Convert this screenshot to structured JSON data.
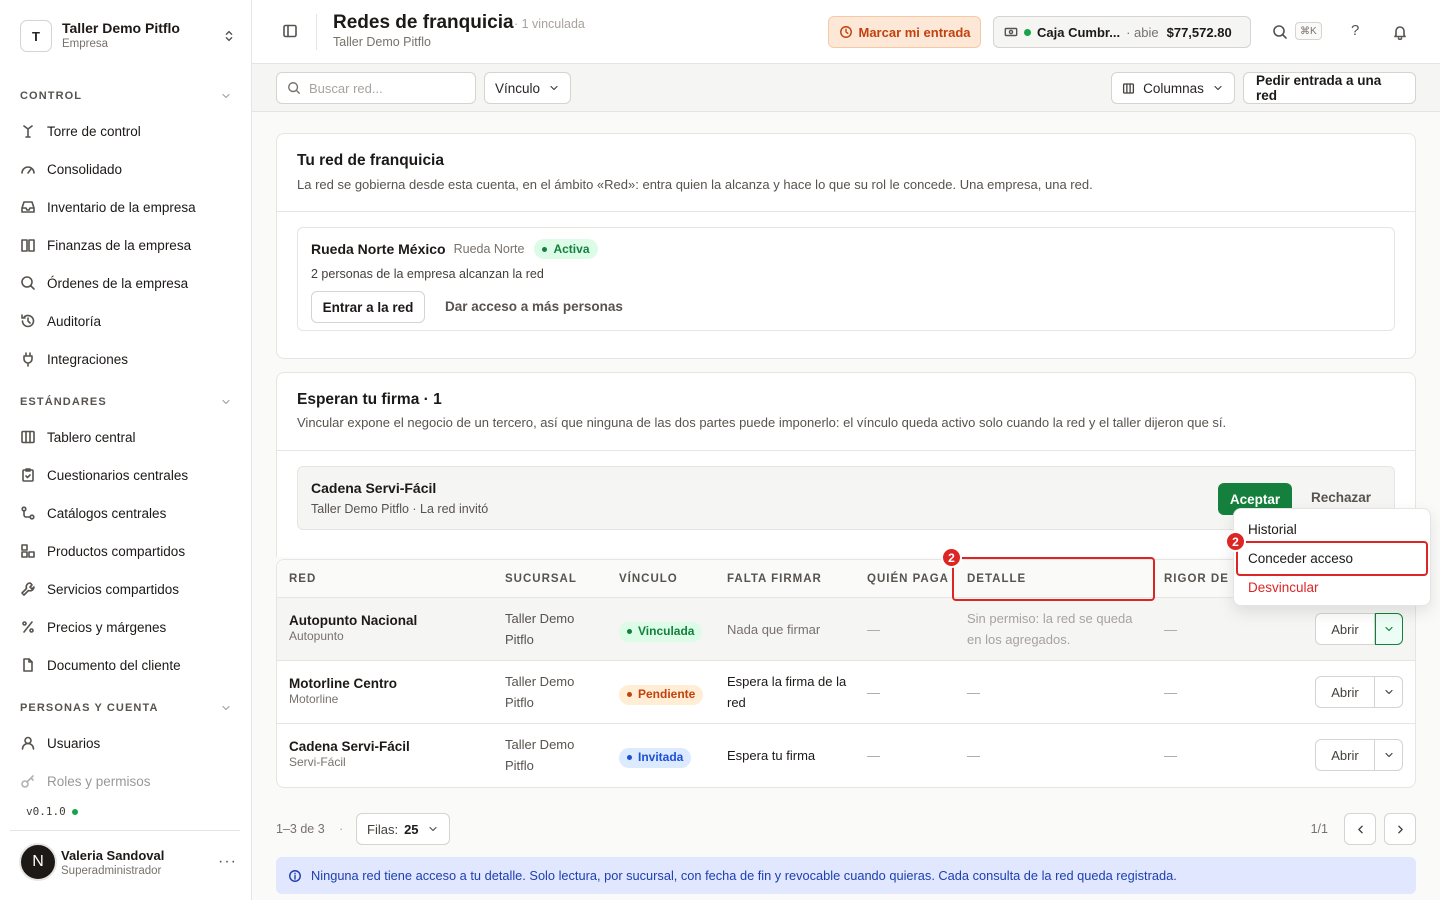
{
  "workspace": {
    "initial": "T",
    "name": "Taller Demo Pitflo",
    "type": "Empresa"
  },
  "sidebar": {
    "sections": [
      {
        "title": "CONTROL",
        "items": [
          {
            "label": "Torre de control",
            "icon": "tower-icon"
          },
          {
            "label": "Consolidado",
            "icon": "gauge-icon"
          },
          {
            "label": "Inventario de la empresa",
            "icon": "inbox-icon"
          },
          {
            "label": "Finanzas de la empresa",
            "icon": "book-icon"
          },
          {
            "label": "Órdenes de la empresa",
            "icon": "search-icon"
          },
          {
            "label": "Auditoría",
            "icon": "history-icon"
          },
          {
            "label": "Integraciones",
            "icon": "plug-icon"
          }
        ]
      },
      {
        "title": "ESTÁNDARES",
        "items": [
          {
            "label": "Tablero central",
            "icon": "columns-icon"
          },
          {
            "label": "Cuestionarios centrales",
            "icon": "clipboard-icon"
          },
          {
            "label": "Catálogos centrales",
            "icon": "hierarchy-icon"
          },
          {
            "label": "Productos compartidos",
            "icon": "boxes-icon"
          },
          {
            "label": "Servicios compartidos",
            "icon": "wrench-icon"
          },
          {
            "label": "Precios y márgenes",
            "icon": "percent-icon"
          },
          {
            "label": "Documento del cliente",
            "icon": "document-icon"
          }
        ]
      },
      {
        "title": "PERSONAS Y CUENTA",
        "items": [
          {
            "label": "Usuarios",
            "icon": "user-icon"
          },
          {
            "label": "Roles y permisos",
            "icon": "key-icon"
          }
        ]
      }
    ],
    "version": "v0.1.0",
    "user": {
      "initial": "N",
      "name": "Valeria Sandoval",
      "role": "Superadministrador",
      "more": "···"
    }
  },
  "header": {
    "title": "Redes de franquicia",
    "count": "· 1 vinculada",
    "subtitle": "Taller Demo Pitflo",
    "entry_button": "Marcar mi entrada",
    "cash": {
      "name": "Caja Cumbr...",
      "status": "· abie",
      "amount": "$77,572.80"
    },
    "shortcut": "⌘K",
    "help": "?"
  },
  "toolbar": {
    "search_placeholder": "Buscar red...",
    "filter_label": "Vínculo",
    "columns_label": "Columnas",
    "request_label": "Pedir entrada a una red"
  },
  "own_network": {
    "title": "Tu red de franquicia",
    "description": "La red se gobierna desde esta cuenta, en el ámbito «Red»: entra quien la alcanza y hace lo que su rol le concede. Una empresa, una red.",
    "name": "Rueda Norte México",
    "short": "Rueda Norte",
    "status": "Activa",
    "reach": "2 personas de la empresa alcanzan la red",
    "enter_button": "Entrar a la red",
    "grant_link": "Dar acceso a más personas"
  },
  "pending": {
    "title": "Esperan tu firma · 1",
    "description": "Vincular expone el negocio de un tercero, así que ninguna de las dos partes puede imponerlo: el vínculo queda activo solo cuando la red y el taller dijeron que sí.",
    "name": "Cadena Servi-Fácil",
    "meta": "Taller Demo Pitflo · La red invitó",
    "accept": "Aceptar",
    "reject": "Rechazar"
  },
  "table": {
    "columns": [
      "RED",
      "SUCURSAL",
      "VÍNCULO",
      "FALTA FIRMAR",
      "QUIÉN PAGA",
      "DETALLE",
      "RIGOR DE L"
    ],
    "rows": [
      {
        "name": "Autopunto Nacional",
        "short": "Autopunto",
        "branch": "Taller Demo Pitflo",
        "status": "Vinculada",
        "missing": "Nada que firmar",
        "payer": "—",
        "detail": "Sin permiso: la red se queda en los agregados.",
        "rigor": "—",
        "action": "Abrir"
      },
      {
        "name": "Motorline Centro",
        "short": "Motorline",
        "branch": "Taller Demo Pitflo",
        "status": "Pendiente",
        "missing": "Espera la firma de la red",
        "payer": "—",
        "detail": "—",
        "rigor": "—",
        "action": "Abrir"
      },
      {
        "name": "Cadena Servi-Fácil",
        "short": "Servi-Fácil",
        "branch": "Taller Demo Pitflo",
        "status": "Invitada",
        "missing": "Espera tu firma",
        "payer": "—",
        "detail": "—",
        "rigor": "—",
        "action": "Abrir"
      }
    ]
  },
  "pagination": {
    "range": "1–3 de 3",
    "rows_label": "Filas:",
    "rows_value": "25",
    "page": "1/1"
  },
  "notice": "Ninguna red tiene acceso a tu detalle. Solo lectura, por sucursal, con fecha de fin y revocable cuando quieras. Cada consulta de la red queda registrada.",
  "menu": {
    "items": [
      "Historial",
      "Conceder acceso",
      "Desvincular"
    ]
  },
  "annotations": {
    "badge_menu": "2",
    "badge_column": "2"
  },
  "colors": {
    "accent_green": "#15803d",
    "danger": "#dc2626",
    "warning": "#c2410c",
    "info": "#1d4ed8"
  }
}
